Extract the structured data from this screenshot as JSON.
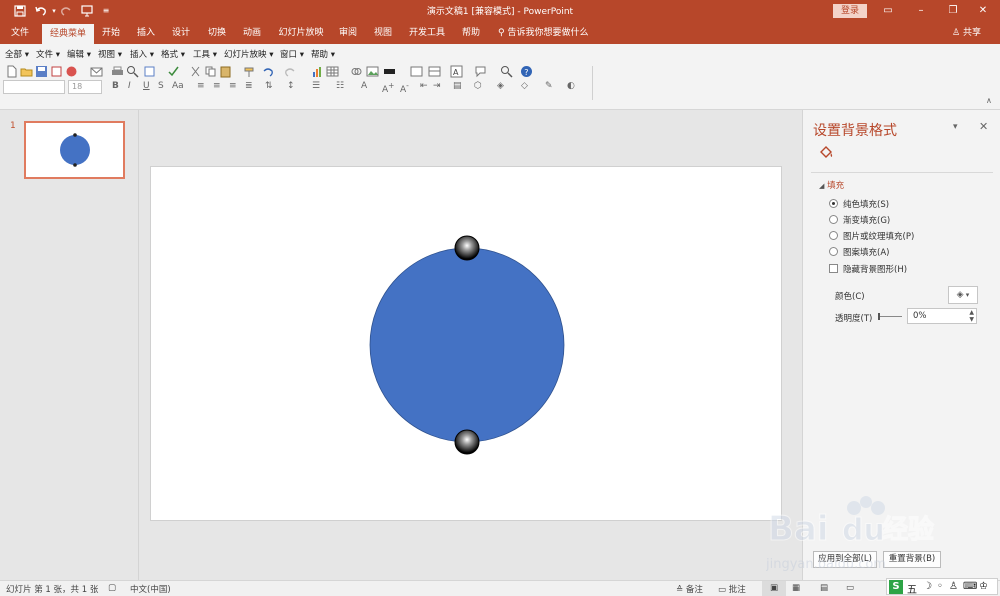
{
  "window": {
    "title": "演示文稿1 [兼容模式]  -  PowerPoint",
    "login_label": "登录",
    "share_label": "共享"
  },
  "tabs": [
    "文件",
    "经典菜单",
    "开始",
    "插入",
    "设计",
    "切换",
    "动画",
    "幻灯片放映",
    "审阅",
    "视图",
    "开发工具",
    "帮助"
  ],
  "active_tab": "经典菜单",
  "tell_me": "告诉我你想要做什么",
  "menus": [
    "全部",
    "文件",
    "编辑",
    "视图",
    "插入",
    "格式",
    "工具",
    "幻灯片放映",
    "窗口",
    "帮助"
  ],
  "font_size_value": "18",
  "slides": {
    "numbers": [
      "1"
    ]
  },
  "format_pane": {
    "title": "设置背景格式",
    "section": "填充",
    "fill_options": [
      "纯色填充(S)",
      "渐变填充(G)",
      "图片或纹理填充(P)",
      "图案填充(A)"
    ],
    "selected_fill": "纯色填充(S)",
    "hide_bg_label": "隐藏背景图形(H)",
    "hide_bg_checked": false,
    "color_label": "颜色(C)",
    "transparency_label": "透明度(T)",
    "transparency_value": "0%",
    "apply_all_label": "应用到全部(L)",
    "reset_label": "重置背景(B)"
  },
  "status": {
    "slide_info": "幻灯片 第 1 张，共 1 张",
    "language": "中文(中国)",
    "notes_label": "备注",
    "comments_label": "批注"
  },
  "watermark": {
    "text": "Bai",
    "text2": "du",
    "text_cn": "经验",
    "url": "jingyan.baidu.com"
  },
  "colors": {
    "accent": "#b7472a",
    "shape_fill": "#4472c4",
    "shape_stroke": "#2f528f"
  }
}
